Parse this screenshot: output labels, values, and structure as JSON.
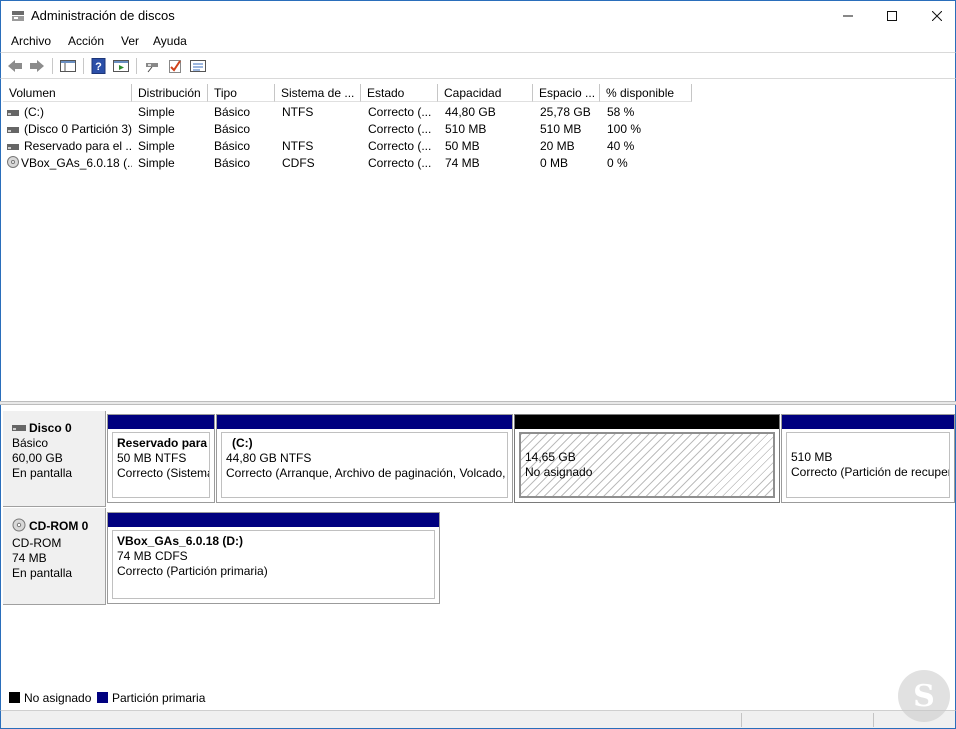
{
  "window": {
    "title": "Administración de discos"
  },
  "menu": [
    "Archivo",
    "Acción",
    "Ver",
    "Ayuda"
  ],
  "toolbar": {
    "icons": [
      "back-icon",
      "forward-icon",
      "show-hide-console-tree-icon",
      "help-icon",
      "properties-icon",
      "connect-disk-icon",
      "check-icon",
      "details-icon"
    ]
  },
  "columns": [
    "Volumen",
    "Distribución",
    "Tipo",
    "Sistema de ...",
    "Estado",
    "Capacidad",
    "Espacio ...",
    "% disponible"
  ],
  "volumes": [
    {
      "name": "(C:)",
      "layout": "Simple",
      "type": "Básico",
      "fs": "NTFS",
      "status": "Correcto (...",
      "capacity": "44,80 GB",
      "free": "25,78 GB",
      "pct": "58 %",
      "icon": "drive-icon"
    },
    {
      "name": "(Disco 0 Partición 3)",
      "layout": "Simple",
      "type": "Básico",
      "fs": "",
      "status": "Correcto (...",
      "capacity": "510 MB",
      "free": "510 MB",
      "pct": "100 %",
      "icon": "drive-icon"
    },
    {
      "name": "Reservado para el ...",
      "layout": "Simple",
      "type": "Básico",
      "fs": "NTFS",
      "status": "Correcto (...",
      "capacity": "50 MB",
      "free": "20 MB",
      "pct": "40 %",
      "icon": "drive-icon"
    },
    {
      "name": "VBox_GAs_6.0.18 (...",
      "layout": "Simple",
      "type": "Básico",
      "fs": "CDFS",
      "status": "Correcto (...",
      "capacity": "74 MB",
      "free": "0 MB",
      "pct": "0 %",
      "icon": "cdrom-icon"
    }
  ],
  "disks": [
    {
      "name": "Disco 0",
      "kind": "Básico",
      "size": "60,00 GB",
      "state": "En pantalla",
      "partitions": [
        {
          "name": "Reservado para e",
          "size": "50 MB NTFS",
          "status": "Correcto (Sistema",
          "color": "#00007f",
          "kind": "primary"
        },
        {
          "name": "(C:)",
          "size": "44,80 GB NTFS",
          "status": "Correcto (Arranque, Archivo de paginación, Volcado,",
          "color": "#00007f",
          "kind": "primary"
        },
        {
          "name": "",
          "size": "14,65 GB",
          "status": "No asignado",
          "color": "#000000",
          "kind": "unallocated"
        },
        {
          "name": "",
          "size": "510 MB",
          "status": "Correcto (Partición de recuper",
          "color": "#00007f",
          "kind": "primary"
        }
      ]
    },
    {
      "name": "CD-ROM 0",
      "kind": "CD-ROM",
      "size": "74 MB",
      "state": "En pantalla",
      "partitions": [
        {
          "name": "VBox_GAs_6.0.18  (D:)",
          "size": "74 MB CDFS",
          "status": "Correcto (Partición primaria)",
          "color": "#00007f",
          "kind": "primary"
        }
      ]
    }
  ],
  "legend": [
    {
      "label": "No asignado",
      "color": "#000000"
    },
    {
      "label": "Partición primaria",
      "color": "#00007f"
    }
  ],
  "watermark": "S"
}
